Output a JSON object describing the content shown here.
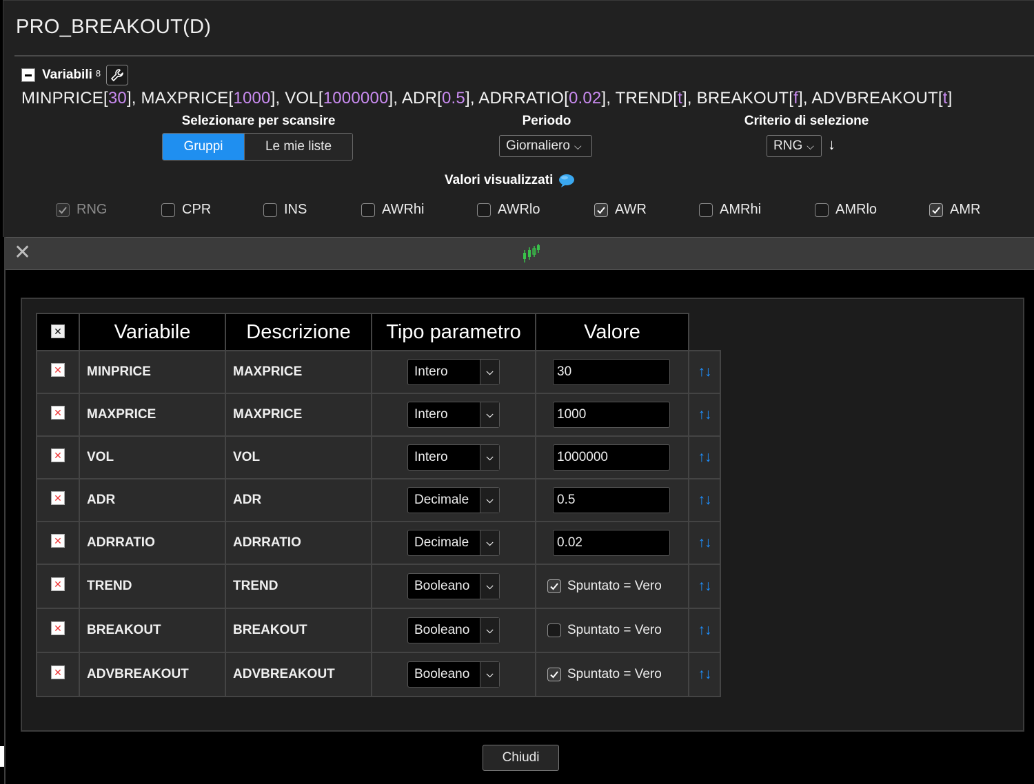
{
  "app": {
    "title": "PRO_BREAKOUT(D)"
  },
  "variables_header": {
    "label": "Variabili",
    "count": "8"
  },
  "variables_line": [
    {
      "name": "MINPRICE",
      "value": "30"
    },
    {
      "name": "MAXPRICE",
      "value": "1000"
    },
    {
      "name": "VOL",
      "value": "1000000"
    },
    {
      "name": "ADR",
      "value": "0.5"
    },
    {
      "name": "ADRRATIO",
      "value": "0.02"
    },
    {
      "name": "TREND",
      "value": "t"
    },
    {
      "name": "BREAKOUT",
      "value": "f"
    },
    {
      "name": "ADVBREAKOUT",
      "value": "t"
    }
  ],
  "scan": {
    "heading": "Selezionare per scansire",
    "options": [
      "Gruppi",
      "Le mie liste"
    ],
    "selected": "Gruppi"
  },
  "periodo": {
    "heading": "Periodo",
    "value": "Giornaliero"
  },
  "criterio": {
    "heading": "Criterio di selezione",
    "value": "RNG",
    "sort_icon": "arrow-down-icon"
  },
  "valori": {
    "heading": "Valori visualizzati",
    "icon": "speech-bubble-icon",
    "items": [
      {
        "label": "RNG",
        "checked": true,
        "disabled": true
      },
      {
        "label": "CPR",
        "checked": false,
        "disabled": false
      },
      {
        "label": "INS",
        "checked": false,
        "disabled": false
      },
      {
        "label": "AWRhi",
        "checked": false,
        "disabled": false
      },
      {
        "label": "AWRlo",
        "checked": false,
        "disabled": false
      },
      {
        "label": "AWR",
        "checked": true,
        "disabled": false
      },
      {
        "label": "AMRhi",
        "checked": false,
        "disabled": false
      },
      {
        "label": "AMRlo",
        "checked": false,
        "disabled": false
      },
      {
        "label": "AMR",
        "checked": true,
        "disabled": false
      }
    ]
  },
  "dialog": {
    "close_icon": "close-icon",
    "logo_icon": "candlestick-chart-icon",
    "table": {
      "headers": [
        "Variabile",
        "Descrizione",
        "Tipo parametro",
        "Valore"
      ],
      "rows": [
        {
          "var": "MINPRICE",
          "desc": "MAXPRICE",
          "type": "Intero",
          "kind": "input",
          "value": "30"
        },
        {
          "var": "MAXPRICE",
          "desc": "MAXPRICE",
          "type": "Intero",
          "kind": "input",
          "value": "1000"
        },
        {
          "var": "VOL",
          "desc": "VOL",
          "type": "Intero",
          "kind": "input",
          "value": "1000000"
        },
        {
          "var": "ADR",
          "desc": "ADR",
          "type": "Decimale",
          "kind": "input",
          "value": "0.5"
        },
        {
          "var": "ADRRATIO",
          "desc": "ADRRATIO",
          "type": "Decimale",
          "kind": "input",
          "value": "0.02"
        },
        {
          "var": "TREND",
          "desc": "TREND",
          "type": "Booleano",
          "kind": "bool",
          "checked": true,
          "bool_label": "Spuntato = Vero"
        },
        {
          "var": "BREAKOUT",
          "desc": "BREAKOUT",
          "type": "Booleano",
          "kind": "bool",
          "checked": false,
          "bool_label": "Spuntato = Vero"
        },
        {
          "var": "ADVBREAKOUT",
          "desc": "ADVBREAKOUT",
          "type": "Booleano",
          "kind": "bool",
          "checked": true,
          "bool_label": "Spuntato = Vero"
        }
      ]
    },
    "close_button": "Chiudi"
  },
  "colors": {
    "accent": "#1f8ff0",
    "value_purple": "#c98bf0",
    "order_arrows": "#1e90ff",
    "delete_red": "#e33333"
  }
}
